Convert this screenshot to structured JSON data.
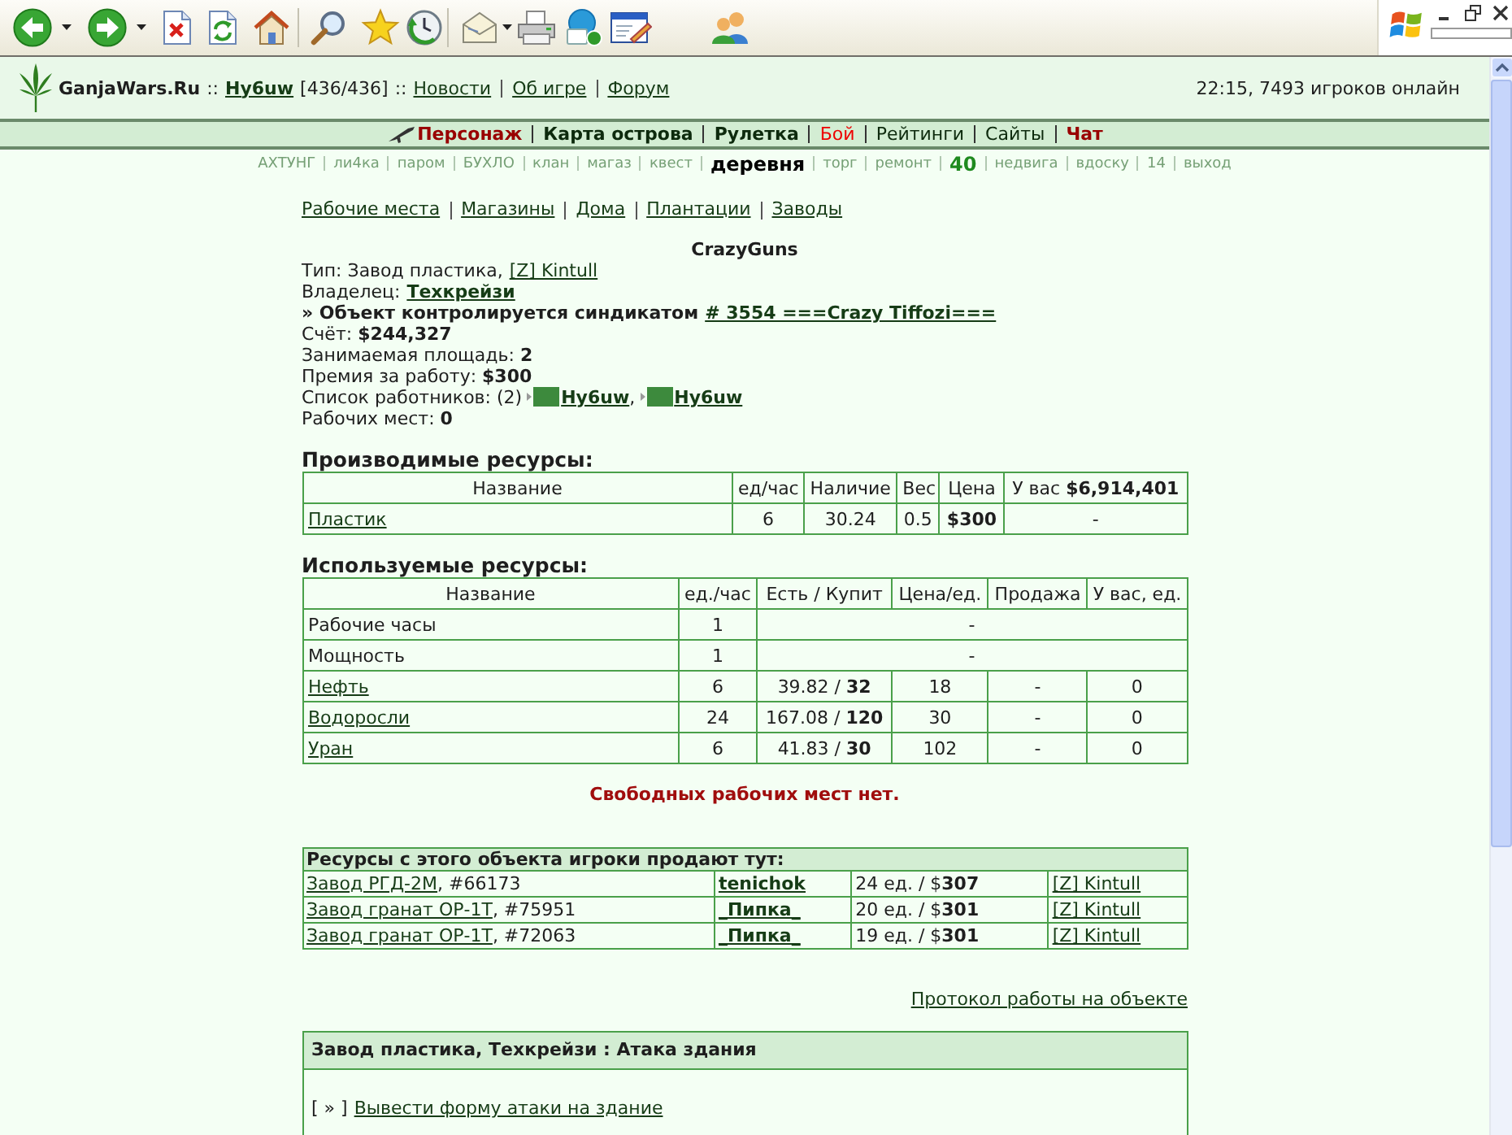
{
  "browser_toolbar": {
    "groups": [
      [
        {
          "kind": "back",
          "dropdown": true
        },
        {
          "kind": "forward",
          "dropdown": true
        },
        {
          "kind": "stop",
          "dropdown": false
        },
        {
          "kind": "refresh",
          "dropdown": false
        },
        {
          "kind": "home",
          "dropdown": false
        }
      ],
      [
        {
          "kind": "search",
          "dropdown": false
        },
        {
          "kind": "favorites",
          "dropdown": false
        },
        {
          "kind": "history",
          "dropdown": false
        }
      ],
      [
        {
          "kind": "mail",
          "dropdown": true
        },
        {
          "kind": "print",
          "dropdown": false
        },
        {
          "kind": "phone",
          "dropdown": false
        },
        {
          "kind": "edit",
          "dropdown": false
        },
        {
          "kind": "messenger",
          "dropdown": false
        }
      ]
    ]
  },
  "window_buttons": [
    {
      "kind": "minimize"
    },
    {
      "kind": "restore"
    },
    {
      "kind": "close"
    }
  ],
  "header": {
    "parts": [
      {
        "kind": "brand",
        "text": "GanjaWars.Ru"
      },
      {
        "kind": "separator",
        "text": "::"
      },
      {
        "kind": "user",
        "text": "Hy6uw"
      },
      {
        "kind": "text",
        "text": "[436/436]"
      },
      {
        "kind": "separator",
        "text": "::"
      },
      {
        "kind": "link",
        "text": "Новости"
      },
      {
        "kind": "link",
        "text": "Об игре"
      },
      {
        "kind": "link",
        "text": "Форум"
      }
    ],
    "status": "22:15, 7493 игроков онлайн"
  },
  "main_nav": {
    "items": [
      {
        "label": "Персонаж",
        "color": "#990000",
        "bold": true
      },
      {
        "label": "Карта острова",
        "color": "#0d2a0d",
        "bold": true
      },
      {
        "label": "Рулетка",
        "color": "#0d2a0d",
        "bold": true
      },
      {
        "label": "Бой",
        "color": "#ee0000",
        "bold": false
      },
      {
        "label": "Рейтинги",
        "color": "#0d2a0d",
        "bold": false
      },
      {
        "label": "Сайты",
        "color": "#0d2a0d",
        "bold": false
      },
      {
        "label": "Чат",
        "color": "#990000",
        "bold": true
      }
    ]
  },
  "sub_nav": [
    {
      "label": "АХТУНГ",
      "kind": "link"
    },
    {
      "label": "ли4ка",
      "kind": "link"
    },
    {
      "label": "паром",
      "kind": "link"
    },
    {
      "label": "БУХЛО",
      "kind": "link"
    },
    {
      "label": "клан",
      "kind": "link"
    },
    {
      "label": "магаз",
      "kind": "link"
    },
    {
      "label": "квест",
      "kind": "link"
    },
    {
      "label": "деревня",
      "kind": "current"
    },
    {
      "label": "торг",
      "kind": "link"
    },
    {
      "label": "ремонт",
      "kind": "link"
    },
    {
      "label": "40",
      "kind": "counter"
    },
    {
      "label": "недвига",
      "kind": "link"
    },
    {
      "label": "вдоску",
      "kind": "link"
    },
    {
      "label": "14",
      "kind": "link"
    },
    {
      "label": "выход",
      "kind": "link"
    }
  ],
  "section_links": [
    "Рабочие места",
    "Магазины",
    "Дома",
    "Плантации",
    "Заводы"
  ],
  "object": {
    "title": "CrazyGuns",
    "lines": [
      {
        "kind": "link",
        "text": "Тип: Завод пластика,",
        "link": "[Z] Kintull"
      },
      {
        "kind": "strong-link",
        "text": "Владелец:",
        "link": "Техкрейзи"
      },
      {
        "kind": "strong",
        "text": "» Объект контролируется синдикатом",
        "link": "# 3554 ===Crazy Tiffozi==="
      },
      {
        "kind": "value",
        "text": "Счёт: **$244,327**"
      },
      {
        "kind": "value",
        "text": "Занимаемая площадь: **2**"
      },
      {
        "kind": "value",
        "text": "Премия за работу: **$300**"
      },
      {
        "kind": "workers",
        "text": "Список работников: (2)",
        "workers": [
          {
            "name": "Hy6uw",
            "after": ","
          },
          {
            "name": "Hy6uw"
          }
        ]
      },
      {
        "kind": "value",
        "text": "Рабочих мест: **0**"
      }
    ]
  },
  "produced": {
    "heading": "Производимые ресурсы:",
    "columns": [
      "Название",
      "ед/час",
      "Наличие",
      "Вес",
      "Цена",
      "У вас **$6,914,401**"
    ],
    "rows": [
      {
        "name": "Пластик",
        "link": true,
        "values": [
          "6",
          "30.24",
          "0.5",
          "$300",
          "-"
        ]
      }
    ]
  },
  "used": {
    "heading": "Используемые ресурсы:",
    "columns": [
      "Название",
      "ед./час",
      "Есть / Купит",
      "Цена/ед.",
      "Продажа",
      "У вас, ед."
    ],
    "rows": [
      {
        "name": "Рабочие часы",
        "link": false,
        "values": [
          "1",
          "-"
        ]
      },
      {
        "name": "Мощность",
        "link": false,
        "values": [
          "1",
          "-"
        ]
      },
      {
        "name": "Нефть",
        "link": true,
        "values": [
          "6",
          "39.82 / **32**",
          "18",
          "-",
          "0"
        ]
      },
      {
        "name": "Водоросли",
        "link": true,
        "values": [
          "24",
          "167.08 / **120**",
          "30",
          "-",
          "0"
        ]
      },
      {
        "name": "Уран",
        "link": true,
        "values": [
          "6",
          "41.83 / **30**",
          "102",
          "-",
          "0"
        ]
      }
    ]
  },
  "notice": "Свободных рабочих мест нет.",
  "sales": {
    "title": "Ресурсы с этого объекта игроки продают тут:",
    "rows": [
      {
        "place": "Завод РГД-2М",
        "number": ", #66173",
        "seller": "tenichok",
        "offer": "24 ед. / $**307**",
        "owner": "[Z] Kintull"
      },
      {
        "place": "Завод гранат ОР-1Т",
        "number": ", #75951",
        "seller": "_Пипка_",
        "offer": "20 ед. / $**301**",
        "owner": "[Z] Kintull"
      },
      {
        "place": "Завод гранат ОР-1Т",
        "number": ", #72063",
        "seller": "_Пипка_",
        "offer": "19 ед. / $**301**",
        "owner": "[Z] Kintull"
      }
    ]
  },
  "protocol_link": "Протокол работы на объекте",
  "attack": {
    "title": "Завод пластика, Техкрейзи : Атака здания",
    "prefix": "[ » ]",
    "link": "Вывести форму атаки на здание"
  }
}
